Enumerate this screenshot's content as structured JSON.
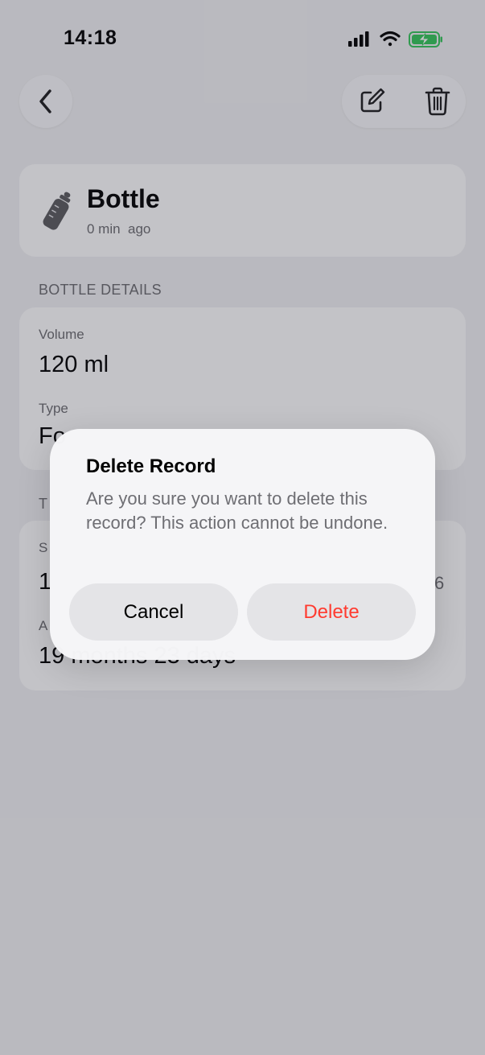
{
  "status_bar": {
    "time": "14:18"
  },
  "record": {
    "title": "Bottle",
    "time_ago": "0 min  ago"
  },
  "bottle_details": {
    "header": "BOTTLE DETAILS",
    "volume_label": "Volume",
    "volume_value": "120 ml",
    "type_label": "Type",
    "type_value_visible": "Fo"
  },
  "time_section": {
    "header_visible": "T",
    "start_label_visible": "S",
    "start_value_visible": "1",
    "start_value_trailing_visible": "6",
    "age_label_visible": "A",
    "age_value": "19 months 23 days"
  },
  "alert": {
    "title": "Delete Record",
    "message": "Are you sure you want to delete this record? This action cannot be undone.",
    "cancel_label": "Cancel",
    "delete_label": "Delete"
  },
  "colors": {
    "destructive": "#ff3b30",
    "battery_charging": "#34c759"
  },
  "icons": {
    "back": "chevron-left-icon",
    "edit": "square-pencil-icon",
    "delete": "trash-icon",
    "record_type": "baby-bottle-icon"
  }
}
